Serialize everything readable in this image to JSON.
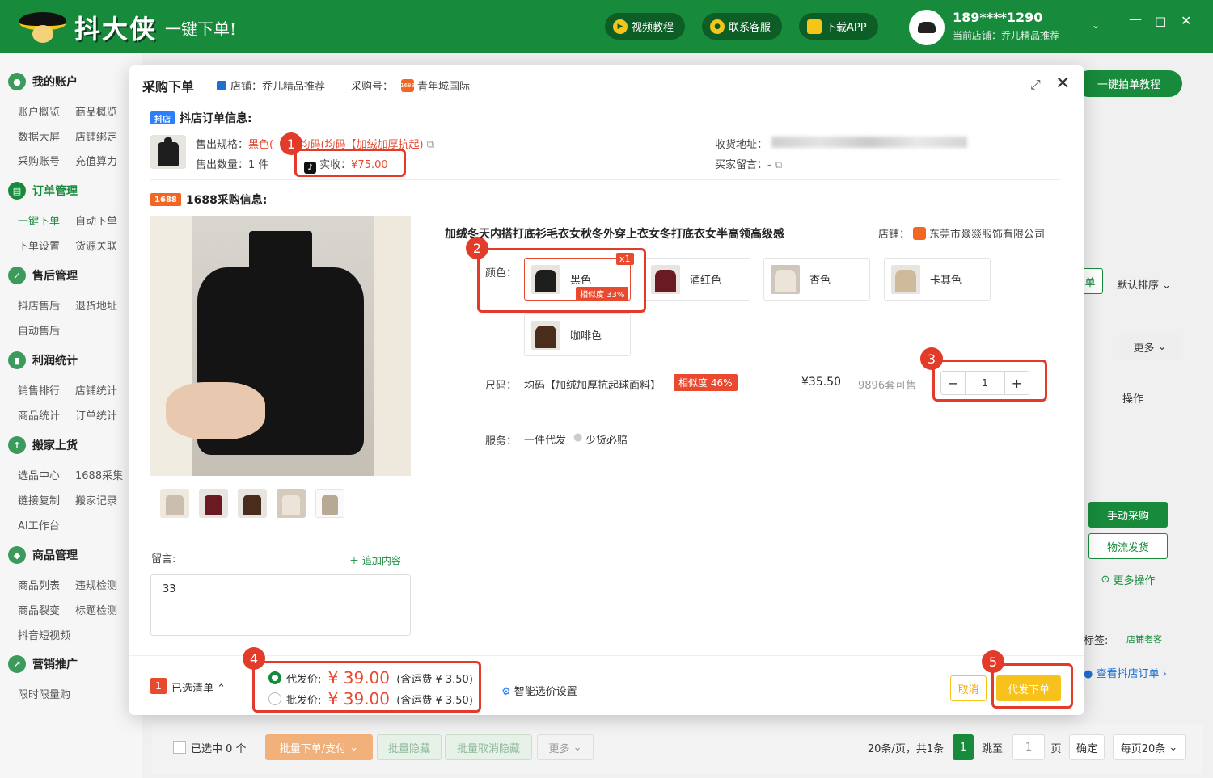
{
  "app": {
    "logo_text": "抖大侠",
    "logo_sub": "一键下单!",
    "top_buttons": [
      "视频教程",
      "联系客服",
      "下载APP"
    ],
    "user_phone": "189****1290",
    "current_shop": "当前店铺：乔儿精品推荐",
    "avatar_text": "乔儿精品推荐"
  },
  "sidebar": {
    "sections": [
      {
        "title": "我的账户",
        "items": [
          "账户概览",
          "商品概览",
          "数据大屏",
          "店铺绑定",
          "采购账号",
          "充值算力"
        ]
      },
      {
        "title": "订单管理",
        "items": [
          "一键下单",
          "自动下单",
          "下单设置",
          "货源关联"
        ]
      },
      {
        "title": "售后管理",
        "items": [
          "抖店售后",
          "退货地址",
          "自动售后"
        ]
      },
      {
        "title": "利润统计",
        "items": [
          "销售排行",
          "店铺统计",
          "商品统计",
          "订单统计"
        ]
      },
      {
        "title": "搬家上货",
        "items": [
          "选品中心",
          "1688采集",
          "链接复制",
          "搬家记录",
          "AI工作台"
        ]
      },
      {
        "title": "商品管理",
        "items": [
          "商品列表",
          "违规检测",
          "商品裂变",
          "标题检测",
          "抖音短视频"
        ]
      },
      {
        "title": "营销推广",
        "items": [
          "限时限量购"
        ]
      }
    ]
  },
  "background": {
    "tutorial_button": "一键拍单教程",
    "sort_label": "默认排序",
    "more_label": "更多",
    "operation_header": "操作",
    "manual_purchase": "手动采购",
    "logistics": "物流发货",
    "more_ops": "更多操作",
    "tag_label": "标签:",
    "tag_value": "店铺老客",
    "view_order": "查看抖店订单",
    "btn_single": "单",
    "selected_count": "已选中 0 个",
    "batch_order": "批量下单/支付",
    "batch_hide": "批量隐藏",
    "batch_unhide": "批量取消隐藏",
    "batch_more": "更多",
    "pagination_info": "20条/页，共1条",
    "current_page": "1",
    "goto_label": "跳至",
    "goto_value": "1",
    "page_unit": "页",
    "confirm": "确定",
    "per_page": "每页20条"
  },
  "modal": {
    "title": "采购下单",
    "shop_label": "店铺：乔儿精品推荐",
    "purchase_label": "采购号：",
    "purchase_value": "青年城国际",
    "douyin_section": {
      "tag": "抖店",
      "title": "抖店订单信息:",
      "spec_label": "售出规格：",
      "spec_value_prefix": "黑色(",
      "spec_value_suffix": ":均码(均码【加绒加厚抗起)",
      "qty_label": "售出数量：",
      "qty_value": "1 件",
      "paid_label": "实收：",
      "paid_value": "¥75.00",
      "address_label": "收货地址：",
      "note_label": "买家留言：",
      "note_value": "-"
    },
    "purchase_section": {
      "tag": "1688",
      "title": "1688采购信息:",
      "product_title": "加绒冬天内搭打底衫毛衣女秋冬外穿上衣女冬打底衣女半高领高级感",
      "store_label": "店铺：",
      "store_name": "东莞市燚燚服饰有限公司",
      "color_label": "颜色：",
      "colors": [
        {
          "name": "黑色",
          "swatch": "#1e1e1e",
          "bg": "#e8e5e0"
        },
        {
          "name": "酒红色",
          "swatch": "#6a1a22",
          "bg": "#e8e5e0"
        },
        {
          "name": "杏色",
          "swatch": "#ece4d8",
          "bg": "#cfc7bb"
        },
        {
          "name": "卡其色",
          "swatch": "#cdbb9c",
          "bg": "#e8e5e0"
        },
        {
          "name": "咖啡色",
          "swatch": "#4a2c1c",
          "bg": "#e8e5e0"
        }
      ],
      "selected_badge": "x1",
      "selected_similarity": "相似度 33%",
      "size_label": "尺码：",
      "size_value": "均码【加绒加厚抗起球面料】",
      "size_similarity": "相似度 46%",
      "price": "¥35.50",
      "stock": "9896套可售",
      "quantity": "1",
      "service_label": "服务：",
      "service_1": "一件代发",
      "service_2": "少货必赔",
      "message_label": "留言:",
      "add_content": "追加内容",
      "message_value": "33"
    },
    "annotations": [
      "1",
      "2",
      "3",
      "4",
      "5"
    ],
    "footer": {
      "cart_count": "1",
      "cart_label": "已选清单",
      "dropship_label": "代发价:",
      "dropship_price": "¥ 39.00",
      "dropship_shipping": "(含运费 ¥ 3.50)",
      "wholesale_label": "批发价:",
      "wholesale_price": "¥ 39.00",
      "wholesale_shipping": "(含运费 ¥ 3.50)",
      "smart_select": "智能选价设置",
      "cancel": "取消",
      "submit": "代发下单"
    }
  },
  "colors": {
    "brand_green": "#178a3c",
    "accent_red": "#e23b2a",
    "price_red": "#e8492f",
    "submit_yellow": "#f7c21b"
  }
}
